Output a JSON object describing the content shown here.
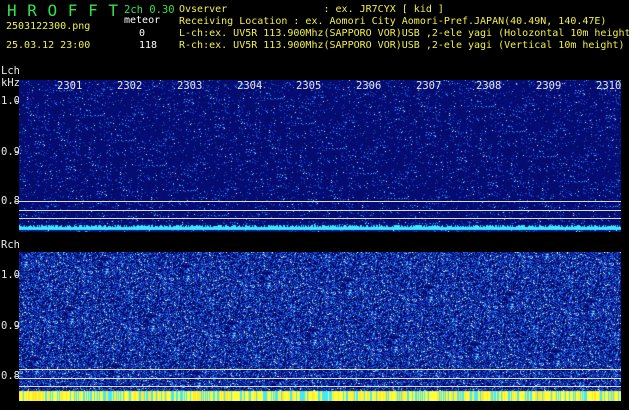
{
  "header": {
    "title": "H R O F F T",
    "channel_mode": "2ch 0.30",
    "filename": "2503122300.png",
    "meteor_label": "meteor",
    "datetime": "25.03.12 23:00",
    "lch_count": "0",
    "rch_count": "118",
    "observer": "Ovserver                : ex. JR7CYX [ kid ]",
    "location": "Receiving Location : ex. Aomori City Aomori-Pref.JAPAN(40.49N, 140.47E)",
    "lch_desc": "L-ch:ex. UV5R 113.900Mhz(SAPPORO VOR)USB ,2-ele yagi (Holozontal 10m height)",
    "rch_desc": "R-ch:ex. UV5R 113.900Mhz(SAPPORO VOR)USB ,2-ele yagi (Vertical 10m height)"
  },
  "lch_panel": {
    "label": "Lch",
    "unit": "kHz",
    "y_ticks": [
      "1.0",
      "0.9",
      "0.8"
    ],
    "x_ticks": [
      "2301",
      "2302",
      "2303",
      "2304",
      "2305",
      "2306",
      "2307",
      "2308",
      "2309",
      "2310"
    ]
  },
  "rch_panel": {
    "label": "Rch",
    "y_ticks": [
      "1.0",
      "0.9",
      "0.8"
    ]
  },
  "colors": {
    "background": "#000000",
    "spectrogram_low": "#0a1a8a",
    "spectrogram_high": "#5ff0ff",
    "header_green": "#31e24a",
    "header_yellow": "#f2f04a"
  }
}
